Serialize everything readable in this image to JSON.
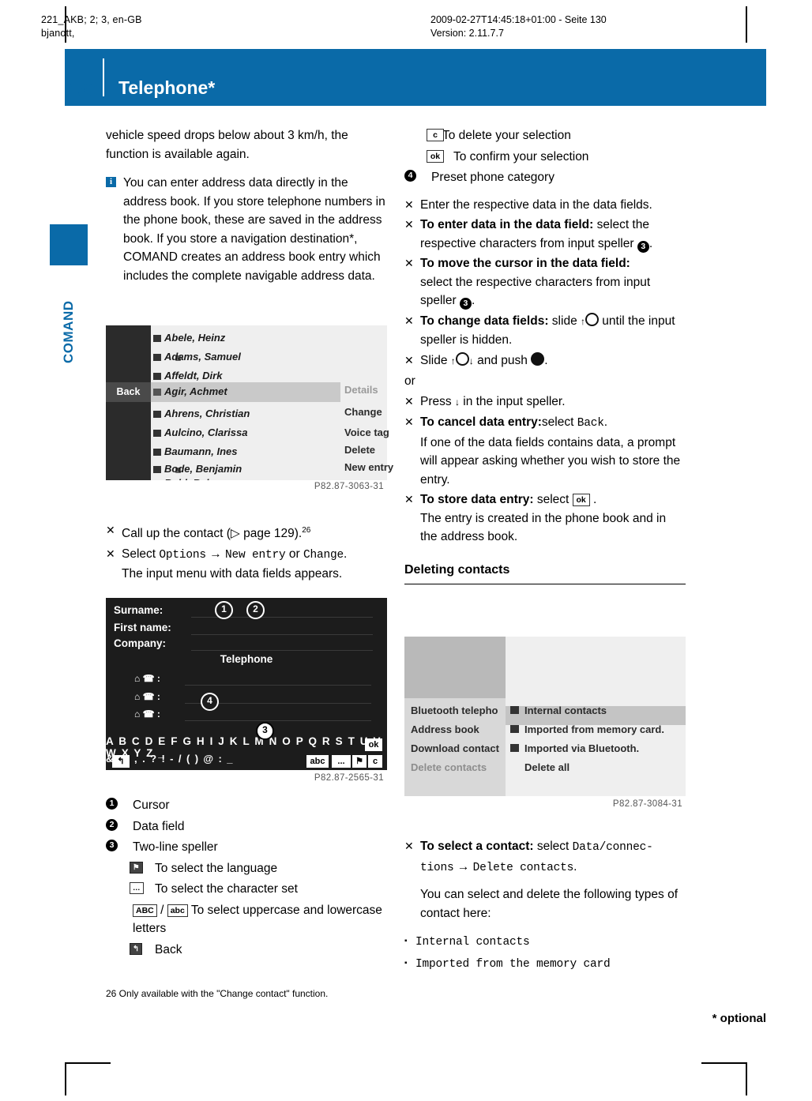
{
  "header": {
    "meta_left_line1": "221_AKB; 2; 3, en-GB",
    "meta_left_line2": "bjanott,",
    "meta_center_line1": "2009-02-27T14:45:18+01:00 - Seite 130",
    "meta_center_line2": "Version: 2.11.7.7"
  },
  "title": {
    "page_number": "130",
    "chapter": "Telephone*"
  },
  "sidetab": {
    "label": "COMAND"
  },
  "left_column": {
    "intro": "vehicle speed drops below about 3 km/h, the function is available again.",
    "note": "You can enter address data directly in the address book. If you store telephone numbers in the phone book, these are saved in the address book. If you store a navigation destination*, COMAND creates an address book entry which includes the complete navigable address data.",
    "shot1": {
      "caption": "P82.87-3063-31",
      "back_label": "Back",
      "entries": [
        "Abele, Heinz",
        "Adams, Samuel",
        "Affeldt, Dirk",
        "Agir, Achmet",
        "Ahrens, Christian",
        "Aulcino, Clarissa",
        "Baumann, Ines",
        "Bode, Benjamin",
        "Buhl, Rebecca"
      ],
      "menu": [
        "Details",
        "Change",
        "Voice tag",
        "Delete",
        "New entry"
      ]
    },
    "steps": [
      {
        "marker": "X",
        "text_parts": [
          "Call up the contact (",
          "page 129).",
          "26"
        ]
      },
      {
        "marker": "X",
        "text": "Select Options → New entry or Change.",
        "sub": "The input menu with data fields appears."
      }
    ],
    "step1_pre": "Call up the contact (",
    "step1_post": " page 129).",
    "step1_sup": "26",
    "step2_pre": "Select ",
    "step2_mono1": "Options",
    "step2_mid1": " → ",
    "step2_mono2": "New entry",
    "step2_mid2": " or ",
    "step2_mono3": "Change",
    "step2_end": ".",
    "step2_sub": "The input menu with data fields appears.",
    "shot2": {
      "caption": "P82.87-2565-31",
      "fields": [
        "Surname:",
        "First name:",
        "Company:"
      ],
      "telephone_header": "Telephone",
      "row_alpha": "A B C D E F G H I J K L M N O P Q R S T U V W X Y Z _",
      "row_sym": "& ' ; , . ? ! - / ( ) @ : _",
      "ok_key": "ok",
      "abc_key": "abc",
      "dots_key": "...",
      "c_key": "c",
      "callouts": [
        "1",
        "2",
        "3",
        "4"
      ]
    },
    "legend": [
      {
        "num": "①",
        "label": "Cursor"
      },
      {
        "num": "②",
        "label": "Data field"
      },
      {
        "num": "③",
        "label": "Two-line speller"
      }
    ],
    "legend_sub": [
      {
        "icon": "flag",
        "label": "To select the language"
      },
      {
        "icon": "...",
        "label": "To select the character set"
      },
      {
        "icon": "ABC/abc",
        "label": "To select uppercase and lowercase letters"
      },
      {
        "icon": "back",
        "label": "Back"
      }
    ],
    "footnote": "26 Only available with the \"Change contact\" function."
  },
  "right_column": {
    "legend_top": [
      {
        "icon": "c",
        "label": "To delete your selection"
      },
      {
        "icon": "ok",
        "label": "To confirm your selection"
      },
      {
        "num": "④",
        "label": "Preset phone category"
      }
    ],
    "steps": [
      {
        "text": "Enter the respective data in the data fields."
      },
      {
        "bold": "To enter data in the data field:",
        "rest": " select the respective characters from input speller ③."
      },
      {
        "bold": "To move the cursor in the data field:",
        "rest": " select the respective characters from input speller ③."
      },
      {
        "bold": "To change data fields:",
        "rest": " slide ↑○ until the input speller is hidden."
      },
      {
        "rest": "Slide ↑○↓ and push ◉."
      }
    ],
    "step_enter": "Enter the respective data in the data fields.",
    "step_enter_data_bold": "To enter data in the data field:",
    "step_enter_data_rest": " select the respective characters from input speller ",
    "step_move_bold": "To move the cursor in the data field:",
    "step_move_rest": "select the respective characters from input speller ",
    "step_change_bold": "To change data fields:",
    "step_change_rest1": " slide ",
    "step_change_rest2": " until the input speller is hidden.",
    "step_slide_pre": "Slide ",
    "step_slide_post": " and push ",
    "step_slide_end": ".",
    "or": "or",
    "step_press_pre": "Press ",
    "step_press_post": " in the input speller.",
    "step_cancel_bold": "To cancel data entry:",
    "step_cancel_rest": "select ",
    "step_cancel_mono": "Back",
    "step_cancel_end": ".",
    "step_cancel_sub": "If one of the data fields contains data, a prompt will appear asking whether you wish to store the entry.",
    "step_store_bold": "To store data entry:",
    "step_store_rest": " select ",
    "step_store_key": "ok",
    "step_store_end": " .",
    "step_store_sub": "The entry is created in the phone book and in the address book.",
    "section_title": "Deleting contacts",
    "shot3": {
      "caption": "P82.87-3084-31",
      "left_items": [
        "Bluetooth telepho",
        "Address book",
        "Download contact",
        "Delete contacts"
      ],
      "right_items": [
        "Internal contacts",
        "Imported from memory card.",
        "Imported via Bluetooth.",
        "Delete all"
      ]
    },
    "select_contact_bold": "To select a contact:",
    "select_contact_rest": " select ",
    "select_contact_mono1": "Data/connec-",
    "select_contact_mono2": "tions",
    "select_contact_arrow": " → ",
    "select_contact_mono3": "Delete contacts",
    "select_contact_end": ".",
    "types_intro": "You can select and delete the following types of contact here:",
    "types": [
      "Internal contacts",
      "Imported from the memory card"
    ]
  },
  "footer": {
    "optional": "* optional"
  }
}
